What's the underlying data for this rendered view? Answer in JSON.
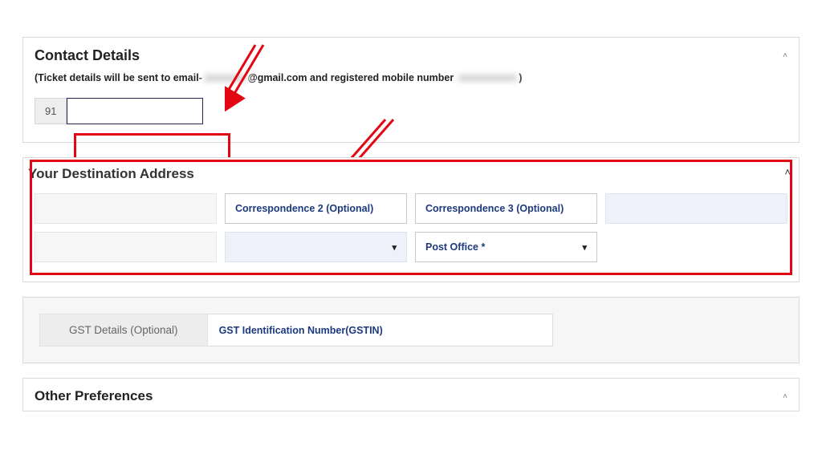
{
  "contact": {
    "title": "Contact Details",
    "info_prefix": "(Ticket details will be sent to email-",
    "email_masked": "xxxxxxx",
    "email_suffix": "@gmail.com and registered mobile number ",
    "mobile_masked": "xxxxxxxxxx",
    "info_close": ")",
    "country_code": "91",
    "phone_value": ""
  },
  "destination": {
    "title": "Your Destination Address",
    "fields": {
      "corr1_value": "",
      "corr2_placeholder": "Correspondence 2 (Optional)",
      "corr3_placeholder": "Correspondence 3 (Optional)",
      "pin_value": "",
      "state_value": "",
      "city_value": "",
      "post_office_placeholder": "Post Office *"
    }
  },
  "gst": {
    "label": "GST Details (Optional)",
    "input_placeholder": "GST Identification Number(GSTIN)"
  },
  "other": {
    "title": "Other Preferences"
  },
  "icons": {
    "chevron_up": "˄",
    "chevron_down": "▾"
  }
}
